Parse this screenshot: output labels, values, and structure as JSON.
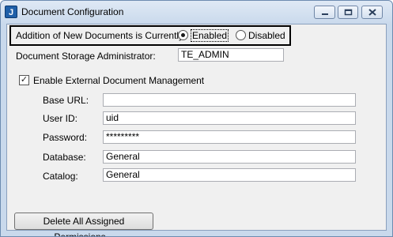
{
  "window": {
    "title": "Document Configuration",
    "icon_letter": "J",
    "controls": {
      "minimize": "minimize-icon",
      "maximize": "maximize-icon",
      "close": "close-icon"
    }
  },
  "addition": {
    "label": "Addition of New Documents is Currently:",
    "options": [
      "Enabled",
      "Disabled"
    ],
    "selected": "Enabled"
  },
  "storage_admin": {
    "label": "Document Storage Administrator:",
    "value": "TE_ADMIN"
  },
  "external": {
    "checkbox_label": "Enable External Document Management",
    "checked": true,
    "fields": {
      "base_url": {
        "label": "Base URL:",
        "value": ""
      },
      "user_id": {
        "label": "User ID:",
        "value": "uid"
      },
      "password": {
        "label": "Password:",
        "value": "*********"
      },
      "database": {
        "label": "Database:",
        "value": "General"
      },
      "catalog": {
        "label": "Catalog:",
        "value": "General"
      }
    }
  },
  "buttons": {
    "delete_permissions": "Delete All Assigned Permissions..."
  }
}
